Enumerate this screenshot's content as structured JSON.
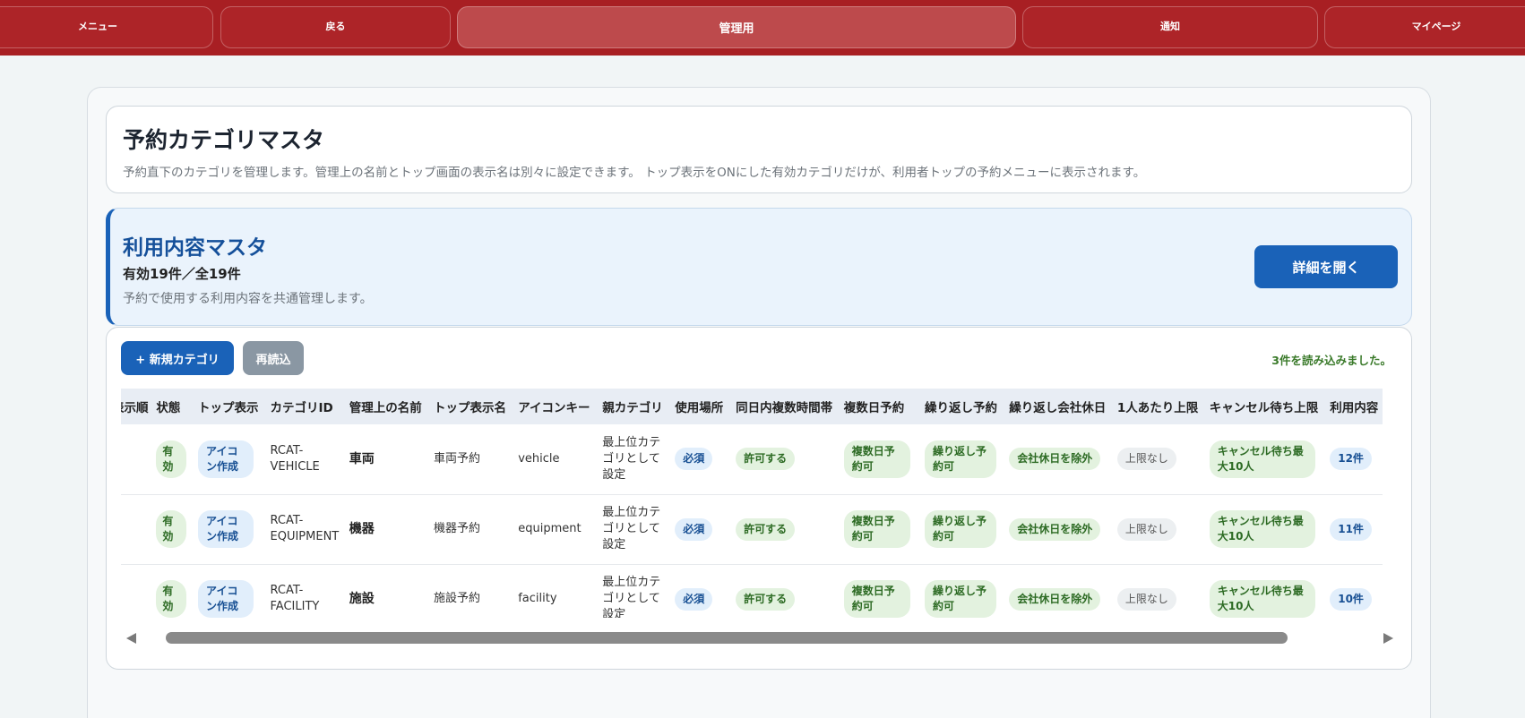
{
  "nav": {
    "menu": "メニュー",
    "back": "戻る",
    "admin": "管理用",
    "notify": "通知",
    "mypage": "マイページ"
  },
  "category_panel": {
    "title": "予約カテゴリマスタ",
    "description": "予約直下のカテゴリを管理します。管理上の名前とトップ画面の表示名は別々に設定できます。 トップ表示をONにした有効カテゴリだけが、利用者トップの予約メニューに表示されます。"
  },
  "usage_panel": {
    "title": "利用内容マスタ",
    "count": "有効19件／全19件",
    "description": "予約で使用する利用内容を共通管理します。",
    "open_button": "詳細を開く"
  },
  "toolbar": {
    "new_button": "+ 新規カテゴリ",
    "reload_button": "再読込",
    "status": "3件を読み込みました。"
  },
  "table": {
    "headers": [
      "表示順",
      "状態",
      "トップ表示",
      "カテゴリID",
      "管理上の名前",
      "トップ表示名",
      "アイコンキー",
      "親カテゴリ",
      "使用場所",
      "同日内複数時間帯",
      "複数日予約",
      "繰り返し予約",
      "繰り返し会社休日",
      "1人あたり上限",
      "キャンセル待ち上限",
      "利用内容"
    ],
    "rows": [
      {
        "order": "",
        "state": "有効",
        "top_display": "アイコン作成",
        "category_id": "RCAT-VEHICLE",
        "admin_name": "車両",
        "top_name": "車両予約",
        "icon_key": "vehicle",
        "parent": "最上位カテゴリとして設定",
        "location": "必須",
        "multi_slot": "許可する",
        "multi_day": "複数日予約可",
        "repeat": "繰り返し予約可",
        "repeat_holiday": "会社休日を除外",
        "per_user_limit": "上限なし",
        "waitlist_limit": "キャンセル待ち最大10人",
        "usage": "12件"
      },
      {
        "order": "",
        "state": "有効",
        "top_display": "アイコン作成",
        "category_id": "RCAT-EQUIPMENT",
        "admin_name": "機器",
        "top_name": "機器予約",
        "icon_key": "equipment",
        "parent": "最上位カテゴリとして設定",
        "location": "必須",
        "multi_slot": "許可する",
        "multi_day": "複数日予約可",
        "repeat": "繰り返し予約可",
        "repeat_holiday": "会社休日を除外",
        "per_user_limit": "上限なし",
        "waitlist_limit": "キャンセル待ち最大10人",
        "usage": "11件"
      },
      {
        "order": "",
        "state": "有効",
        "top_display": "アイコン作成",
        "category_id": "RCAT-FACILITY",
        "admin_name": "施設",
        "top_name": "施設予約",
        "icon_key": "facility",
        "parent": "最上位カテゴリとして設定",
        "location": "必須",
        "multi_slot": "許可する",
        "multi_day": "複数日予約可",
        "repeat": "繰り返し予約可",
        "repeat_holiday": "会社休日を除外",
        "per_user_limit": "上限なし",
        "waitlist_limit": "キャンセル待ち最大10人",
        "usage": "10件"
      }
    ]
  },
  "colors": {
    "nav_bg": "#a81f23",
    "primary": "#1a62b8",
    "success_text": "#2d6b24"
  }
}
